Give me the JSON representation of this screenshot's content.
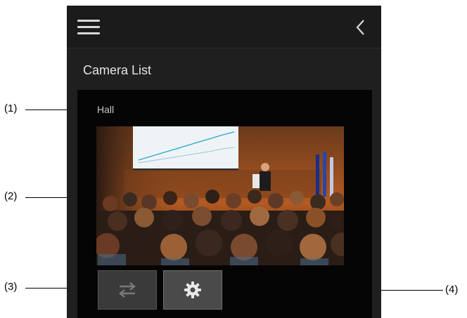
{
  "callouts": {
    "c1": "(1)",
    "c2": "(2)",
    "c3": "(3)",
    "c4": "(4)"
  },
  "header": {
    "menu_icon": "hamburger-menu-icon",
    "back_icon": "chevron-left-icon"
  },
  "main": {
    "section_title": "Camera List",
    "camera": {
      "name": "Hall",
      "thumbnail": "conference-hall-camera-image",
      "buttons": {
        "switch": {
          "icon": "switch-arrows-icon",
          "enabled": false
        },
        "settings": {
          "icon": "gear-icon",
          "enabled": true
        }
      }
    }
  },
  "colors": {
    "panel_bg": "#1f1f1f",
    "card_bg": "#050505",
    "text": "#e4e4e4"
  }
}
